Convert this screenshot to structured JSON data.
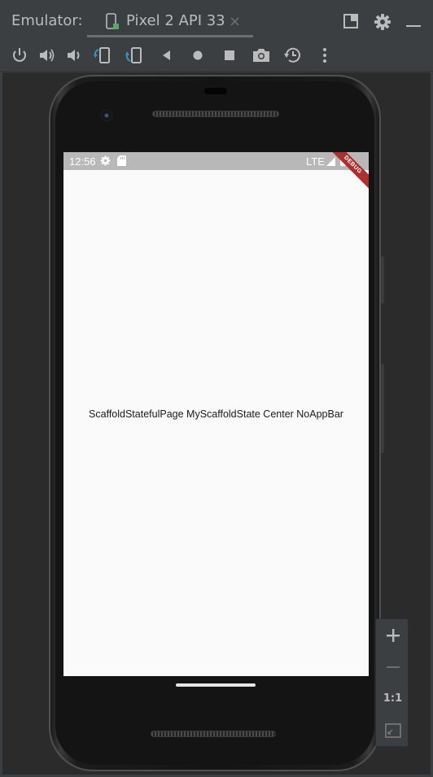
{
  "window": {
    "title_label": "Emulator:",
    "tab_label": "Pixel 2 API 33",
    "tab_close": "×"
  },
  "toolbar": {
    "icons": [
      "power-icon",
      "volume-up-icon",
      "volume-down-icon",
      "rotate-left-icon",
      "rotate-right-icon",
      "back-icon",
      "home-icon",
      "overview-icon",
      "screenshot-icon",
      "snapshot-icon",
      "more-icon"
    ]
  },
  "device": {
    "status_time": "12:56",
    "status_network": "LTE",
    "debug_banner": "DEBUG",
    "center_text": "ScaffoldStatefulPage MyScaffoldState Center NoAppBar"
  },
  "zoom": {
    "zoom_in": "+",
    "zoom_out": "−",
    "actual_size": "1:1"
  },
  "colors": {
    "accent_blue": "#3592c4",
    "debug_red": "#a83232",
    "device_green": "#59a869"
  }
}
